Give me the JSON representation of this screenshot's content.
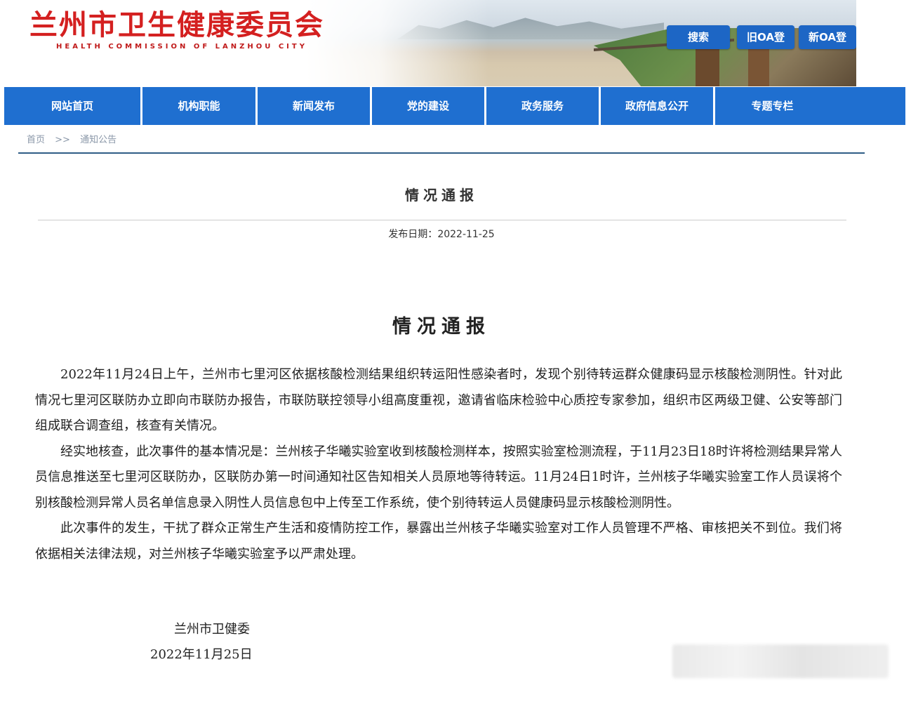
{
  "header": {
    "site_title": "兰州市卫生健康委员会",
    "site_subtitle": "HEALTH COMMISSION OF LANZHOU CITY",
    "buttons": {
      "search": "搜索",
      "old_oa": "旧OA登",
      "new_oa": "新OA登"
    }
  },
  "nav": {
    "items": [
      "网站首页",
      "机构职能",
      "新闻发布",
      "党的建设",
      "政务服务",
      "政府信息公开",
      "专题专栏"
    ]
  },
  "breadcrumb": {
    "home": "首页",
    "separator": ">>",
    "current": "通知公告"
  },
  "article": {
    "heading": "情况通报",
    "pubdate_label": "发布日期：",
    "pubdate_value": "2022-11-25"
  },
  "document": {
    "title": "情况通报",
    "paragraphs": [
      "2022年11月24日上午，兰州市七里河区依据核酸检测结果组织转运阳性感染者时，发现个别待转运群众健康码显示核酸检测阴性。针对此情况七里河区联防办立即向市联防办报告，市联防联控领导小组高度重视，邀请省临床检验中心质控专家参加，组织市区两级卫健、公安等部门组成联合调查组，核查有关情况。",
      "经实地核查，此次事件的基本情况是：兰州核子华曦实验室收到核酸检测样本，按照实验室检测流程，于11月23日18时许将检测结果异常人员信息推送至七里河区联防办，区联防办第一时间通知社区告知相关人员原地等待转运。11月24日1时许，兰州核子华曦实验室工作人员误将个别核酸检测异常人员名单信息录入阴性人员信息包中上传至工作系统，使个别待转运人员健康码显示核酸检测阴性。",
      "此次事件的发生，干扰了群众正常生产生活和疫情防控工作，暴露出兰州核子华曦实验室对工作人员管理不严格、审核把关不到位。我们将依据相关法律法规，对兰州核子华曦实验室予以严肃处理。"
    ],
    "signature_org": "兰州市卫健委",
    "signature_date": "2022年11月25日"
  },
  "colors": {
    "brand_red": "#d42020",
    "nav_blue": "#1f6fd0",
    "button_blue": "#1d66c5"
  }
}
